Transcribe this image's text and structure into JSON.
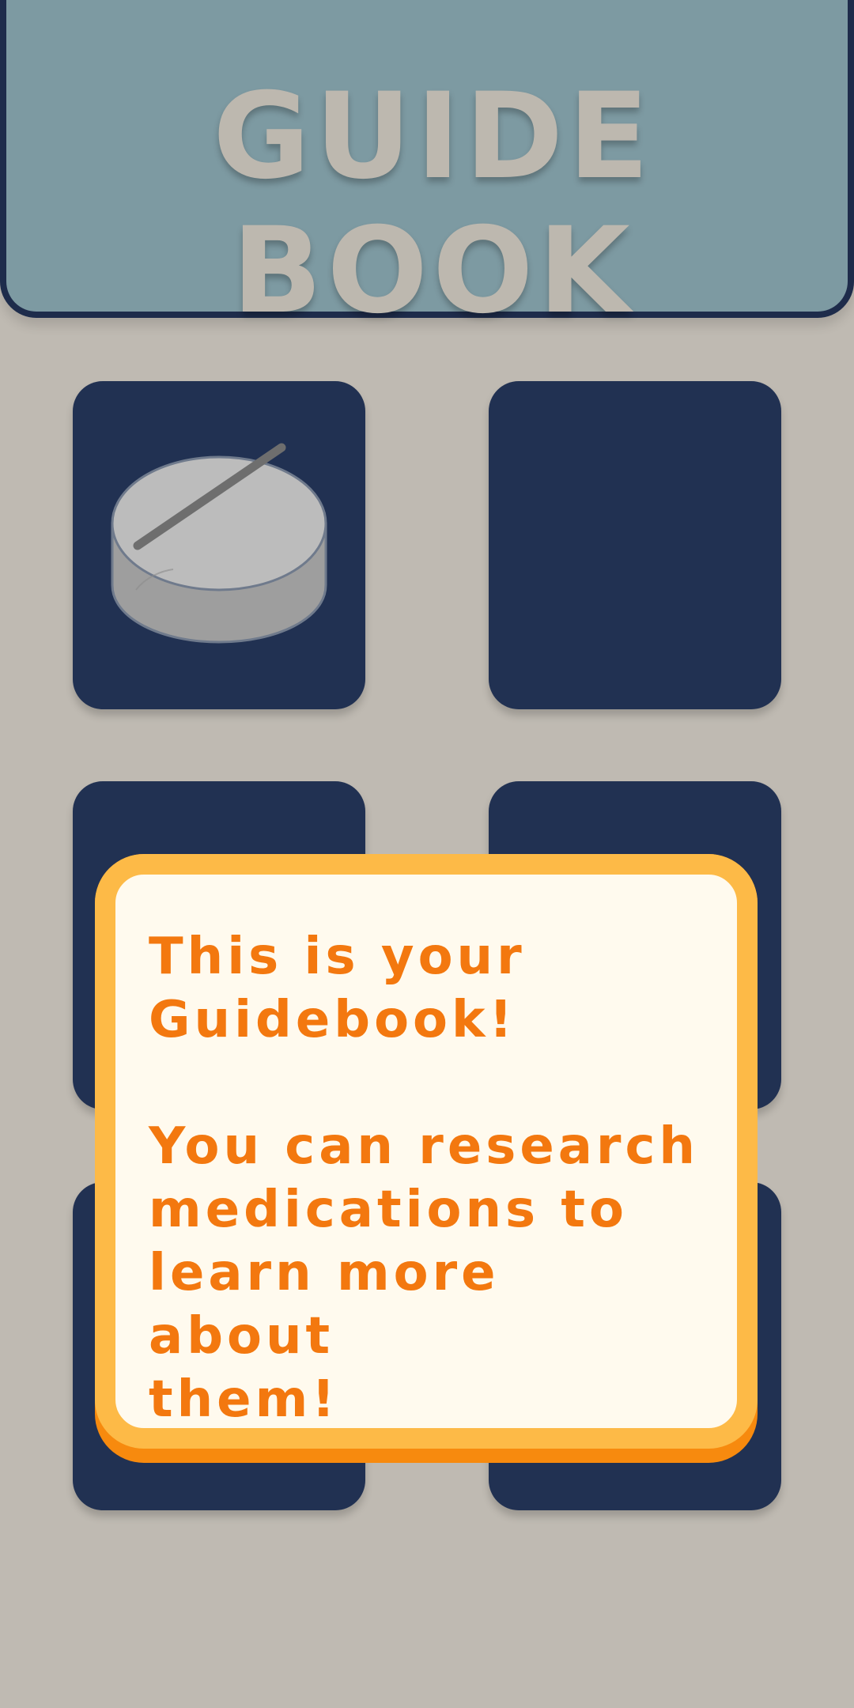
{
  "header": {
    "title": "GUIDE BOOK"
  },
  "slots": [
    {
      "icon": "pill-icon",
      "unlocked": true
    },
    {
      "icon": null,
      "unlocked": false
    },
    {
      "icon": null,
      "unlocked": false
    },
    {
      "icon": null,
      "unlocked": false
    },
    {
      "icon": null,
      "unlocked": false
    },
    {
      "icon": null,
      "unlocked": false
    }
  ],
  "popup": {
    "line1": "This is your\nGuidebook!",
    "line2": "You can research\nmedications to\nlearn more about\nthem!"
  },
  "colors": {
    "background": "#bfbab2",
    "header": "#7d9aa2",
    "header_border": "#1e2c4b",
    "slot": "#213152",
    "popup_text": "#f3780f",
    "popup_border": "#fdba47",
    "popup_shadow": "#f78a0e",
    "popup_fill": "#fffaee"
  }
}
